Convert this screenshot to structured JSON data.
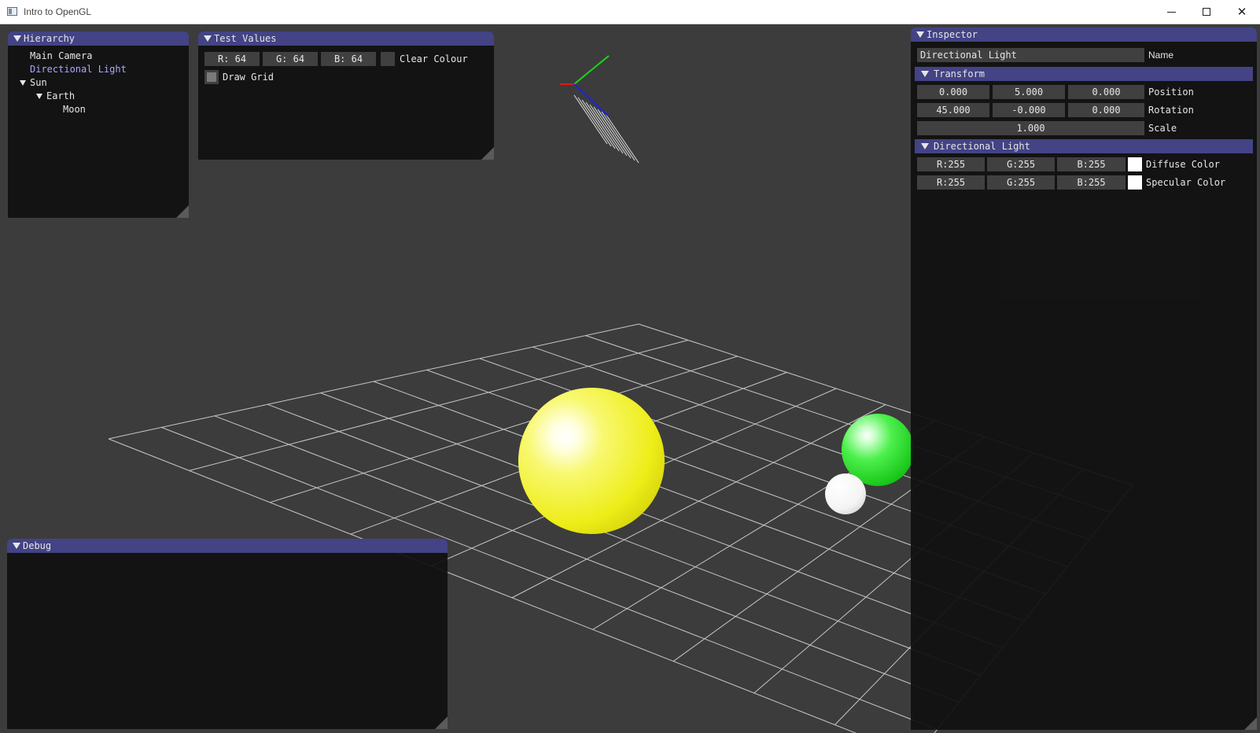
{
  "window": {
    "title": "Intro to OpenGL",
    "icon": "app-window-icon",
    "controls": {
      "minimize": "minimize-icon",
      "maximize": "maximize-icon",
      "close": "✕"
    }
  },
  "hierarchy": {
    "title": "Hierarchy",
    "items": [
      {
        "label": "Main Camera",
        "depth": 0,
        "expandable": false,
        "selected": false
      },
      {
        "label": "Directional Light",
        "depth": 0,
        "expandable": false,
        "selected": true
      },
      {
        "label": "Sun",
        "depth": 0,
        "expandable": true,
        "selected": false
      },
      {
        "label": "Earth",
        "depth": 1,
        "expandable": true,
        "selected": false
      },
      {
        "label": "Moon",
        "depth": 2,
        "expandable": false,
        "selected": false
      }
    ]
  },
  "test_values": {
    "title": "Test Values",
    "r": "R: 64",
    "g": "G: 64",
    "b": "B: 64",
    "clear_colour_label": "Clear Colour",
    "clear_colour": "#404040",
    "draw_grid_label": "Draw Grid",
    "draw_grid_checked": true
  },
  "debug": {
    "title": "Debug"
  },
  "inspector": {
    "title": "Inspector",
    "name_value": "Directional Light",
    "name_label": "Name",
    "transform": {
      "title": "Transform",
      "position": [
        "0.000",
        "5.000",
        "0.000"
      ],
      "position_label": "Position",
      "rotation": [
        "45.000",
        "-0.000",
        "0.000"
      ],
      "rotation_label": "Rotation",
      "scale": "1.000",
      "scale_label": "Scale"
    },
    "directional_light": {
      "title": "Directional Light",
      "diffuse": [
        "R:255",
        "G:255",
        "B:255"
      ],
      "diffuse_label": "Diffuse Color",
      "diffuse_color": "#ffffff",
      "specular": [
        "R:255",
        "G:255",
        "B:255"
      ],
      "specular_label": "Specular Color",
      "specular_color": "#ffffff"
    }
  },
  "scene": {
    "background": "#3c3c3c",
    "grid_color": "#c8c8c8",
    "sun_color": "#f2f22a",
    "earth_color": "#2ee02e",
    "moon_color": "#f2f2f2"
  }
}
